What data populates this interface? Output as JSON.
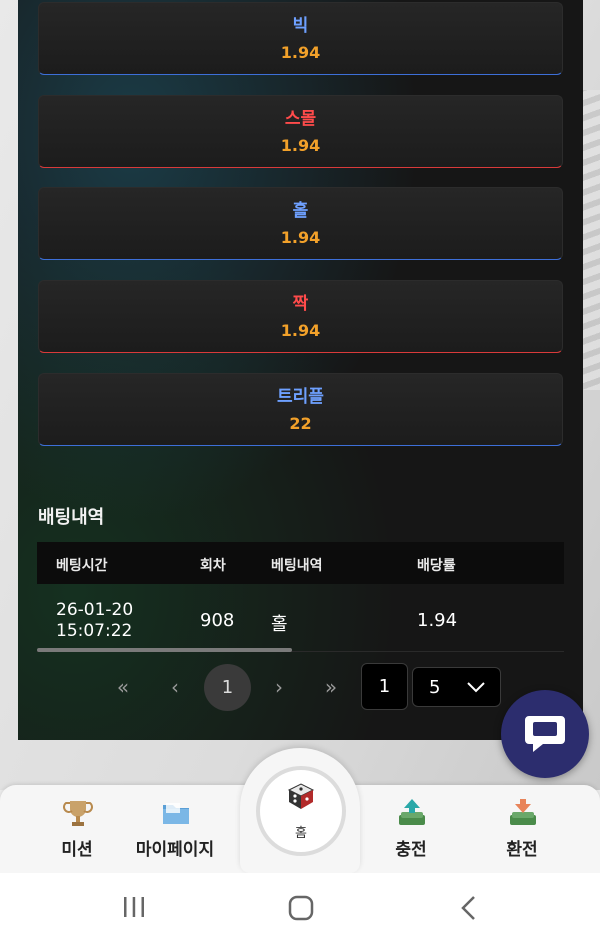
{
  "bets": [
    {
      "name": "빅",
      "odds": "1.94",
      "color": "#6ea0ff"
    },
    {
      "name": "스몰",
      "odds": "1.94",
      "color": "#ff4b4b"
    },
    {
      "name": "홀",
      "odds": "1.94",
      "color": "#6ea0ff"
    },
    {
      "name": "짝",
      "odds": "1.94",
      "color": "#ff4b4b"
    },
    {
      "name": "트리플",
      "odds": "22",
      "color": "#6ea0ff"
    }
  ],
  "history": {
    "title": "배팅내역",
    "columns": [
      "베팅시간",
      "회차",
      "베팅내역",
      "배당률"
    ],
    "rows": [
      {
        "time_date": "26-01-20",
        "time_clock": "15:07:22",
        "round": "908",
        "bet": "홀",
        "odds": "1.94"
      }
    ]
  },
  "pagination": {
    "first": "«",
    "prev": "‹",
    "current": "1",
    "next": "›",
    "last": "»",
    "page_input": "1",
    "page_size": "5"
  },
  "nav": {
    "mission": "미션",
    "mypage": "마이페이지",
    "home": "홈",
    "deposit": "충전",
    "withdraw": "환전"
  },
  "colors": {
    "accent_odds": "#f2a12a",
    "chat_button": "#2c2d6e"
  }
}
